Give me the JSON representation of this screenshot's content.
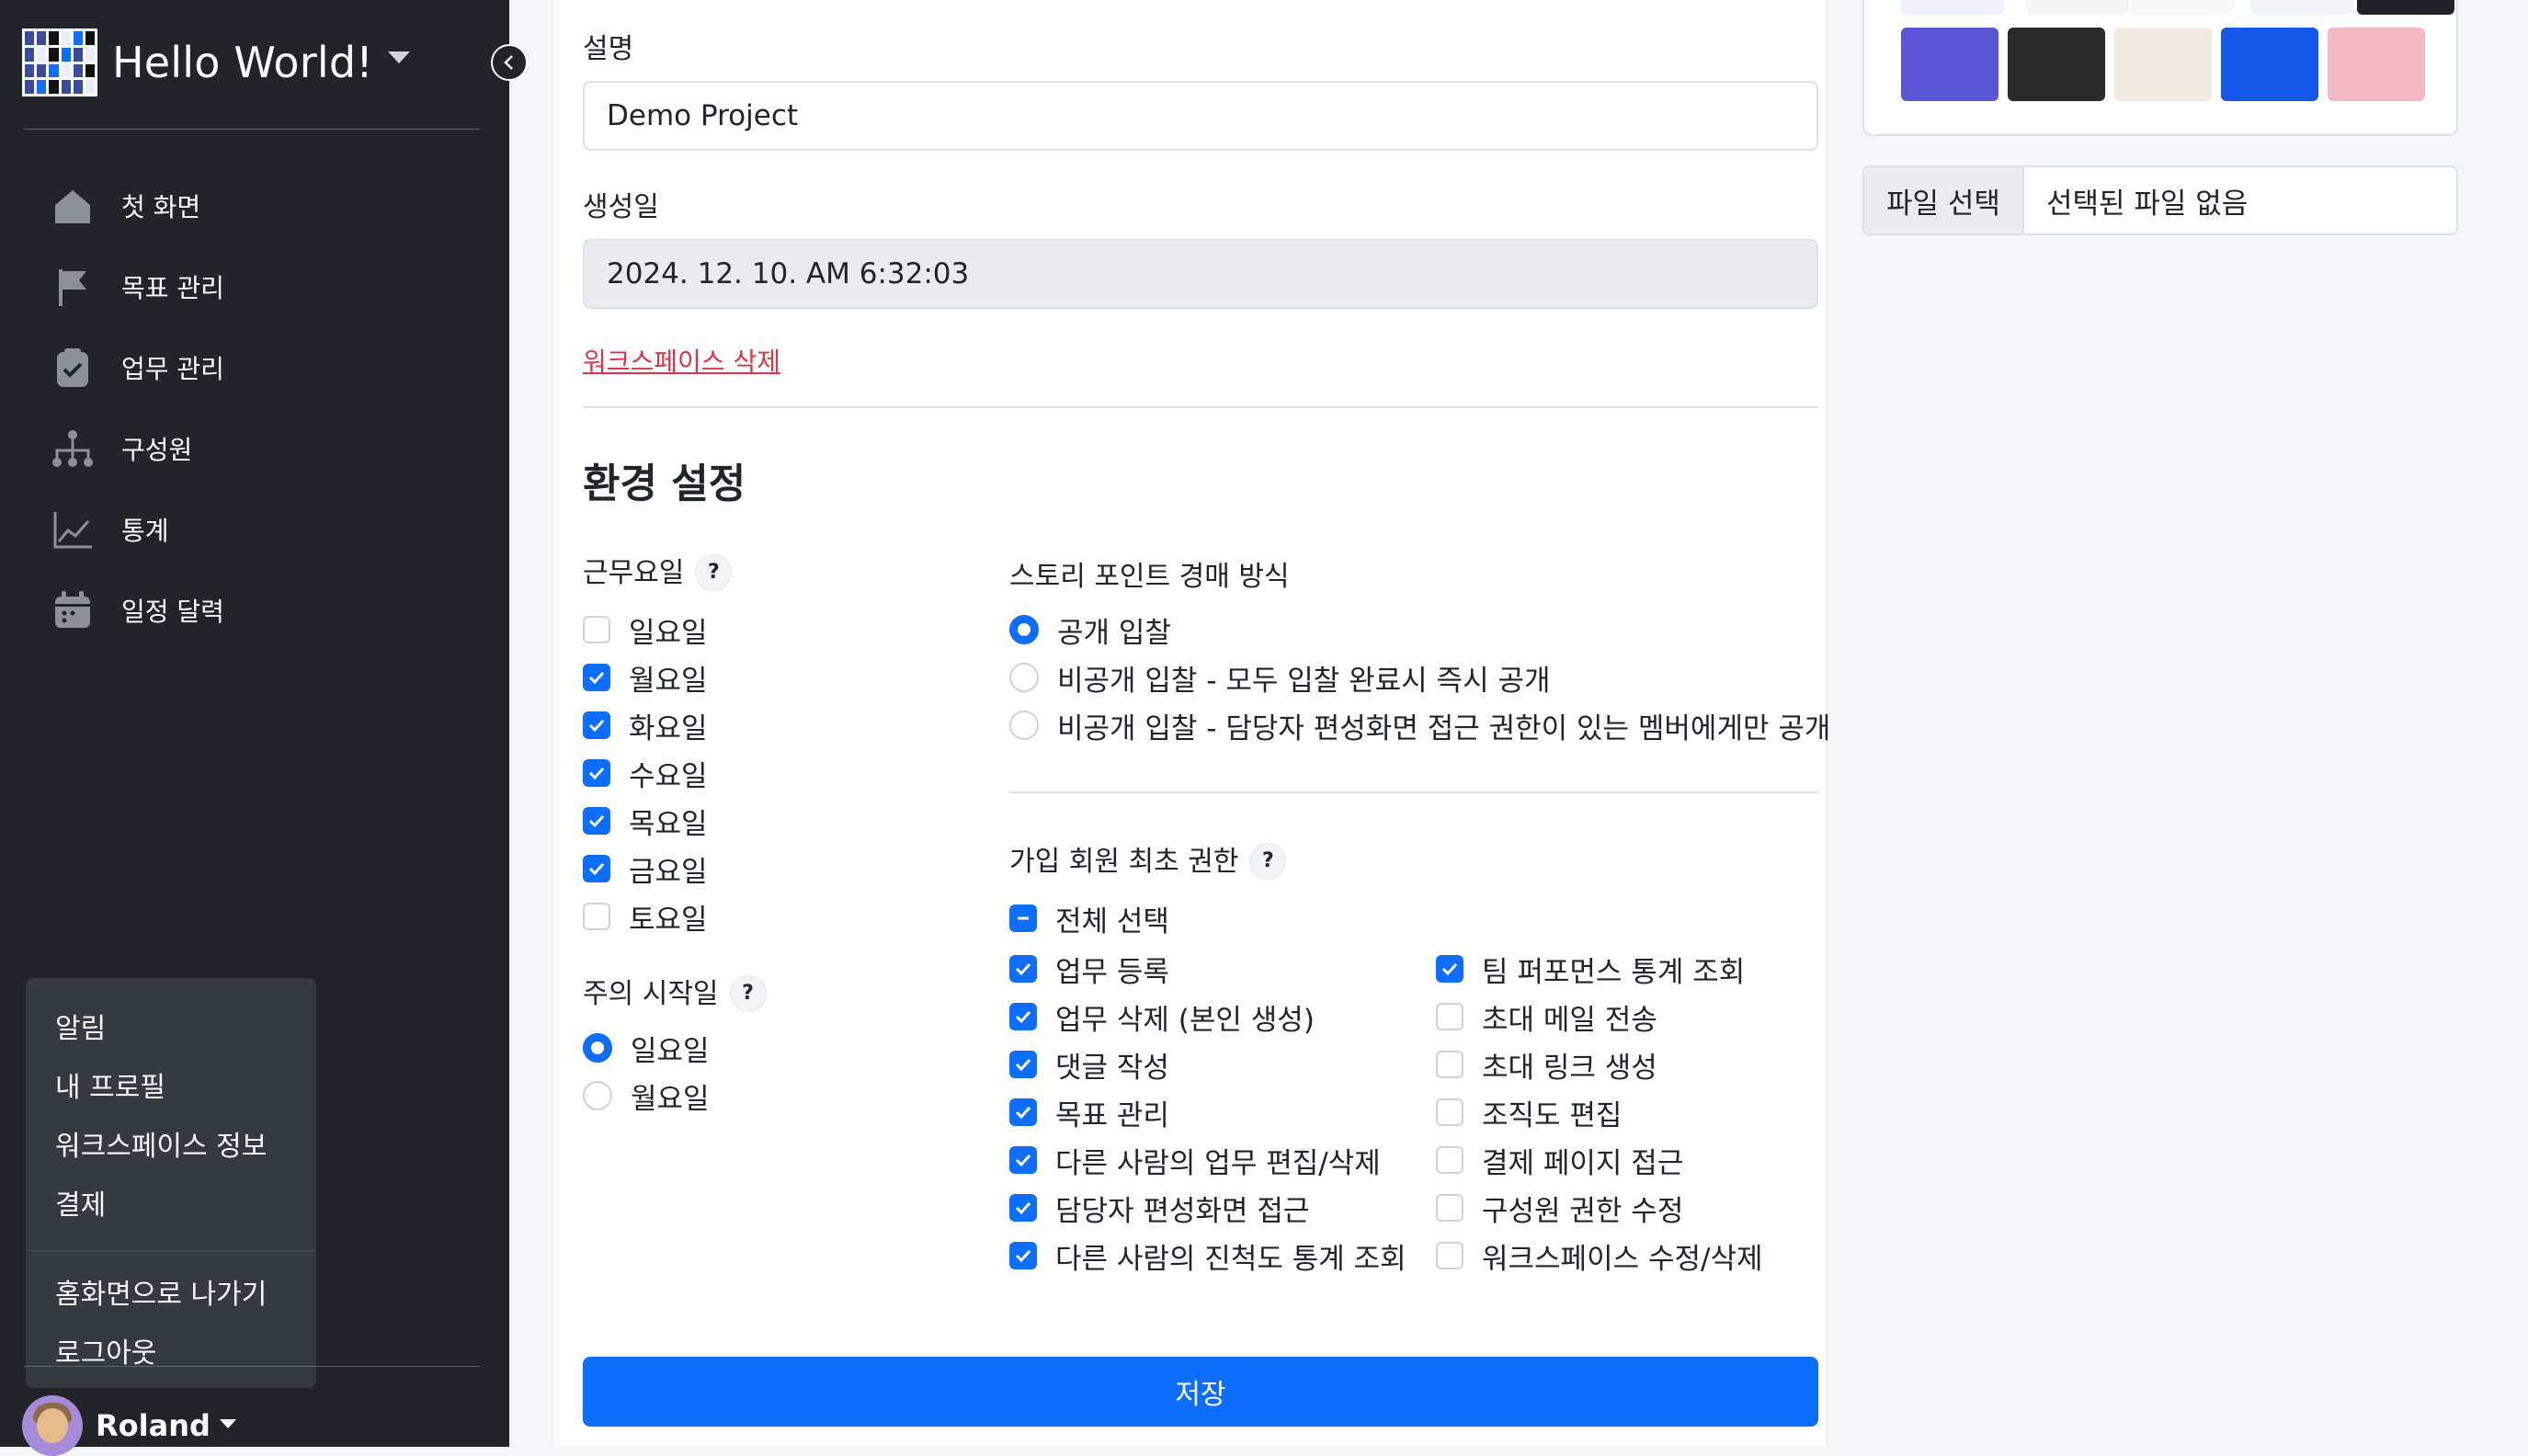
{
  "sidebar": {
    "brand_title": "Hello World!",
    "nav": [
      {
        "label": "첫 화면",
        "icon": "home-icon"
      },
      {
        "label": "목표 관리",
        "icon": "flag-icon"
      },
      {
        "label": "업무 관리",
        "icon": "clipboard-check-icon"
      },
      {
        "label": "구성원",
        "icon": "org-chart-icon"
      },
      {
        "label": "통계",
        "icon": "line-chart-icon"
      },
      {
        "label": "일정 달력",
        "icon": "calendar-icon"
      }
    ],
    "dropdown": {
      "items": [
        "알림",
        "내 프로필",
        "워크스페이스 정보",
        "결제"
      ],
      "bottom_items": [
        "홈화면으로 나가기",
        "로그아웃"
      ]
    },
    "user_name": "Roland"
  },
  "form": {
    "description_label": "설명",
    "description_value": "Demo Project",
    "created_label": "생성일",
    "created_value": "2024. 12. 10. AM 6:32:03",
    "delete_link": "워크스페이스 삭제",
    "section_title": "환경 설정",
    "workdays": {
      "label": "근무요일",
      "help": "?",
      "days": [
        {
          "label": "일요일",
          "checked": false
        },
        {
          "label": "월요일",
          "checked": true
        },
        {
          "label": "화요일",
          "checked": true
        },
        {
          "label": "수요일",
          "checked": true
        },
        {
          "label": "목요일",
          "checked": true
        },
        {
          "label": "금요일",
          "checked": true
        },
        {
          "label": "토요일",
          "checked": false
        }
      ]
    },
    "week_start": {
      "label": "주의 시작일",
      "help": "?",
      "options": [
        {
          "label": "일요일",
          "selected": true
        },
        {
          "label": "월요일",
          "selected": false
        }
      ]
    },
    "auction": {
      "label": "스토리 포인트 경매 방식",
      "options": [
        {
          "label": "공개 입찰",
          "selected": true
        },
        {
          "label": "비공개 입찰 - 모두 입찰 완료시 즉시 공개",
          "selected": false
        },
        {
          "label": "비공개 입찰 - 담당자 편성화면 접근 권한이 있는 멤버에게만 공개",
          "selected": false
        }
      ]
    },
    "permissions": {
      "label": "가입 회원 최초 권한",
      "help": "?",
      "select_all": "전체 선택",
      "left": [
        {
          "label": "업무 등록",
          "checked": true
        },
        {
          "label": "업무 삭제 (본인 생성)",
          "checked": true
        },
        {
          "label": "댓글 작성",
          "checked": true
        },
        {
          "label": "목표 관리",
          "checked": true
        },
        {
          "label": "다른 사람의 업무 편집/삭제",
          "checked": true
        },
        {
          "label": "담당자 편성화면 접근",
          "checked": true
        },
        {
          "label": "다른 사람의 진척도 통계 조회",
          "checked": true
        }
      ],
      "right": [
        {
          "label": "팀 퍼포먼스 통계 조회",
          "checked": true
        },
        {
          "label": "초대 메일 전송",
          "checked": false
        },
        {
          "label": "초대 링크 생성",
          "checked": false
        },
        {
          "label": "조직도 편집",
          "checked": false
        },
        {
          "label": "결제 페이지 접근",
          "checked": false
        },
        {
          "label": "구성원 권한 수정",
          "checked": false
        },
        {
          "label": "워크스페이스 수정/삭제",
          "checked": false
        }
      ]
    },
    "save_label": "저장"
  },
  "file": {
    "button_label": "파일 선택",
    "status_text": "선택된 파일 없음"
  },
  "colors": {
    "primary": "#0d6efd",
    "danger": "#dc3545",
    "sidebar_bg": "#212529"
  }
}
